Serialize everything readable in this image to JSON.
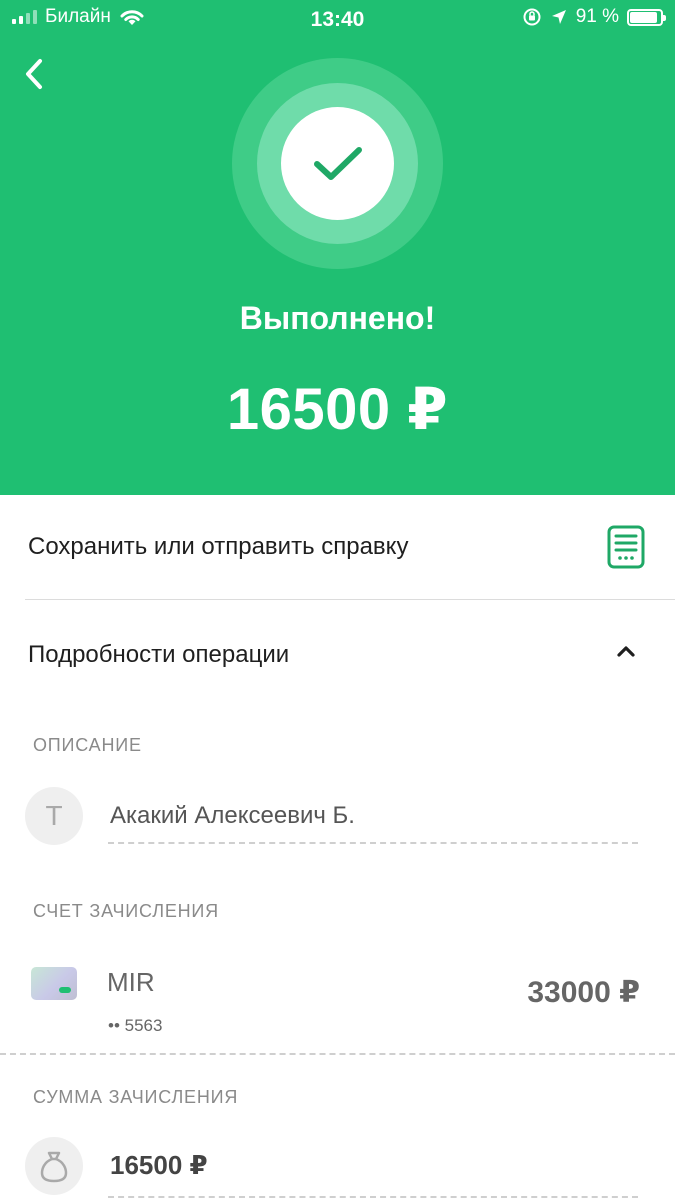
{
  "status_bar": {
    "carrier": "Билайн",
    "time": "13:40",
    "battery_percent": "91 %"
  },
  "header": {
    "title": "Выполнено!",
    "amount": "16500 ₽",
    "background_color": "#1fbf72"
  },
  "actions": {
    "save_label": "Сохранить или отправить справку",
    "details_label": "Подробности операции"
  },
  "details": {
    "description_label": "ОПИСАНИЕ",
    "recipient_initial": "Т",
    "recipient_name": "Акакий Алексеевич Б.",
    "account_label": "СЧЕТ ЗАЧИСЛЕНИЯ",
    "card_name": "MIR",
    "card_mask": "•• 5563",
    "card_balance": "33000 ₽",
    "credit_label": "СУММА ЗАЧИСЛЕНИЯ",
    "credit_amount": "16500 ₽"
  },
  "icons": {
    "back": "chevron-left-icon",
    "success": "checkmark-icon",
    "receipt": "document-icon",
    "collapse": "chevron-up-icon",
    "card": "card-icon",
    "money_bag": "money-bag-icon"
  }
}
